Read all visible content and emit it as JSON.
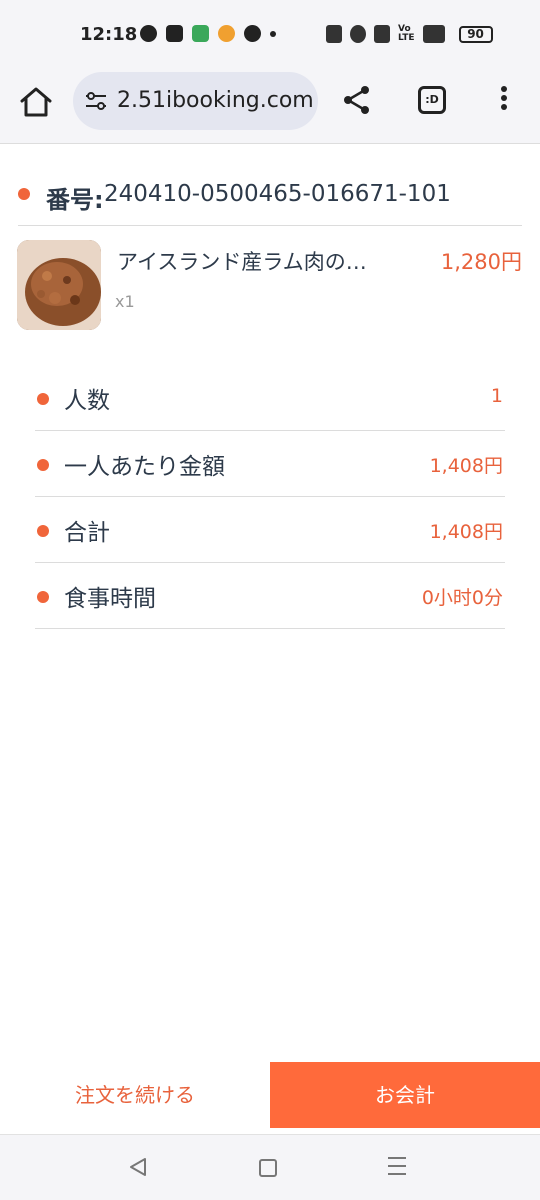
{
  "status_bar": {
    "time": "12:18",
    "battery": "90"
  },
  "browser": {
    "url": "2.51ibooking.com",
    "tab_icon_text": ":D"
  },
  "order": {
    "label": "番号:",
    "number": "240410-0500465-016671-101"
  },
  "item": {
    "name": "アイスランド産ラム肉の…",
    "price": "1,280円",
    "quantity": "x1"
  },
  "details": [
    {
      "label": "人数",
      "value": "1"
    },
    {
      "label": "一人あたり金額",
      "value": "1,408円"
    },
    {
      "label": "合計",
      "value": "1,408円"
    },
    {
      "label": "食事時間",
      "value": "0小时0分"
    }
  ],
  "actions": {
    "continue_label": "注文を続ける",
    "checkout_label": "お会計"
  },
  "colors": {
    "accent": "#f0653a",
    "checkout_bg": "#ff6a3b",
    "text_dark": "#2d3a4a"
  }
}
